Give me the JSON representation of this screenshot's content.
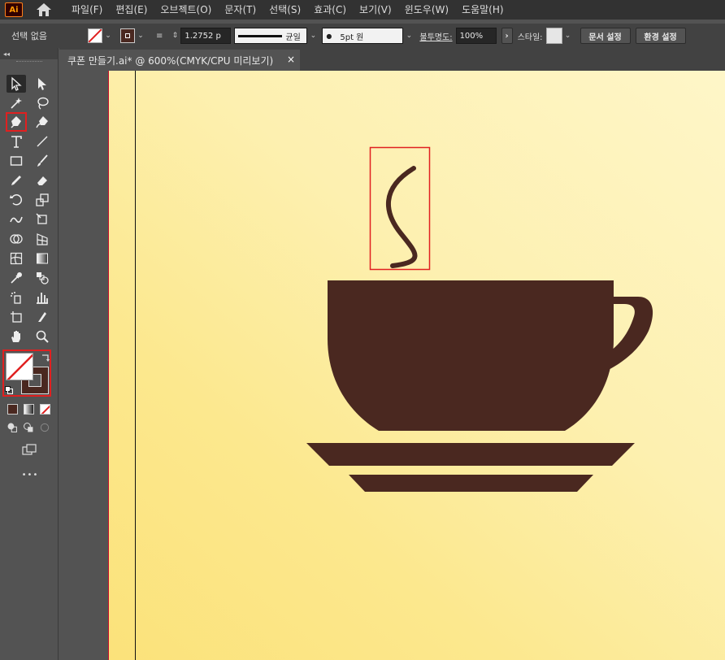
{
  "app": {
    "logo_text": "Ai"
  },
  "menu": [
    "파일(F)",
    "편집(E)",
    "오브젝트(O)",
    "문자(T)",
    "선택(S)",
    "효과(C)",
    "보기(V)",
    "윈도우(W)",
    "도움말(H)"
  ],
  "control_bar": {
    "selection_label": "선택 없음",
    "stroke_weight": "1.2752 p",
    "stroke_profile": "균일",
    "brush": "5pt 원",
    "opacity_label": "불투명도:",
    "opacity_value": "100%",
    "style_label": "스타일:",
    "doc_setup": "문서 설정",
    "preferences": "환경 설정"
  },
  "document": {
    "tab_title": "쿠폰 만들기.ai* @ 600%(CMYK/CPU 미리보기)",
    "close_glyph": "×"
  },
  "toolbar": {
    "more_glyph": "•••",
    "collapse_glyph": "◂◂"
  },
  "colors": {
    "coffee": "#4a2820",
    "highlight": "#e02020",
    "artboard_edge": "#c8102e"
  }
}
